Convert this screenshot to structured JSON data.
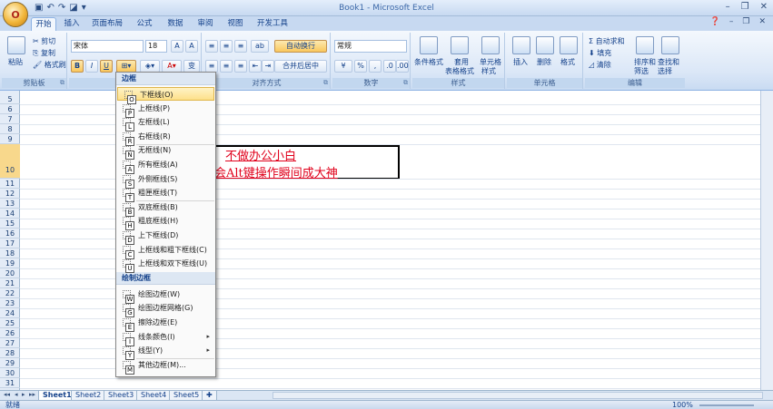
{
  "window": {
    "title": "Book1 - Microsoft Excel",
    "office_button": "O"
  },
  "tabs": [
    "开始",
    "插入",
    "页面布局",
    "公式",
    "数据",
    "审阅",
    "视图",
    "开发工具"
  ],
  "active_tab": "开始",
  "ribbon": {
    "clipboard": {
      "label": "剪贴板",
      "paste": "粘贴",
      "cut": "剪切",
      "copy": "复制",
      "format_painter": "格式刷"
    },
    "font": {
      "label": "字体",
      "family": "宋体",
      "size": "18"
    },
    "alignment": {
      "label": "对齐方式",
      "wrap": "自动换行",
      "merge": "合并后居中"
    },
    "number": {
      "label": "数字",
      "format": "常规"
    },
    "styles": {
      "label": "样式",
      "conditional": "条件格式",
      "table": "套用",
      "table2": "表格格式",
      "cell": "单元格",
      "cell2": "样式"
    },
    "cells": {
      "label": "单元格",
      "insert": "插入",
      "delete": "删除",
      "format": "格式"
    },
    "editing": {
      "label": "编辑",
      "autosum": "Σ 自动求和",
      "fill": "填充",
      "clear": "清除",
      "sort": "排序和",
      "sort2": "筛选",
      "find": "查找和",
      "find2": "选择"
    }
  },
  "rows": [
    "5",
    "6",
    "7",
    "8",
    "9",
    "10",
    "11",
    "12",
    "13",
    "14",
    "15",
    "16",
    "17",
    "18",
    "19",
    "20",
    "21",
    "22",
    "23",
    "24",
    "25",
    "26",
    "27",
    "28",
    "29",
    "30",
    "31"
  ],
  "selected_row": "10",
  "cell_text": {
    "line1": "不做办公小白",
    "line2": "会Alt键操作瞬间成大神"
  },
  "dropdown": {
    "header1": "边框",
    "group1": [
      {
        "label": "下框线(O)",
        "key": "O"
      },
      {
        "label": "上框线(P)",
        "key": "P"
      },
      {
        "label": "左框线(L)",
        "key": "L"
      },
      {
        "label": "右框线(R)",
        "key": "R"
      },
      {
        "label": "无框线(N)",
        "key": "N"
      },
      {
        "label": "所有框线(A)",
        "key": "A"
      },
      {
        "label": "外侧框线(S)",
        "key": "S"
      },
      {
        "label": "粗匣框线(T)",
        "key": "T"
      },
      {
        "label": "双底框线(B)",
        "key": "B"
      },
      {
        "label": "粗底框线(H)",
        "key": "H"
      },
      {
        "label": "上下框线(D)",
        "key": "D"
      },
      {
        "label": "上框线和粗下框线(C)",
        "key": "C"
      },
      {
        "label": "上框线和双下框线(U)",
        "key": "U"
      }
    ],
    "header2": "绘制边框",
    "group2": [
      {
        "label": "绘图边框(W)",
        "key": "W"
      },
      {
        "label": "绘图边框网格(G)",
        "key": "G"
      },
      {
        "label": "擦除边框(E)",
        "key": "E"
      },
      {
        "label": "线条颜色(I)",
        "key": "I",
        "submenu": "▸"
      },
      {
        "label": "线型(Y)",
        "key": "Y",
        "submenu": "▸"
      },
      {
        "label": "其他边框(M)...",
        "key": "M"
      }
    ]
  },
  "sheets": [
    "Sheet1",
    "Sheet2",
    "Sheet3",
    "Sheet4",
    "Sheet5"
  ],
  "active_sheet": "Sheet1",
  "status": {
    "mode": "就绪",
    "zoom": "100%"
  }
}
